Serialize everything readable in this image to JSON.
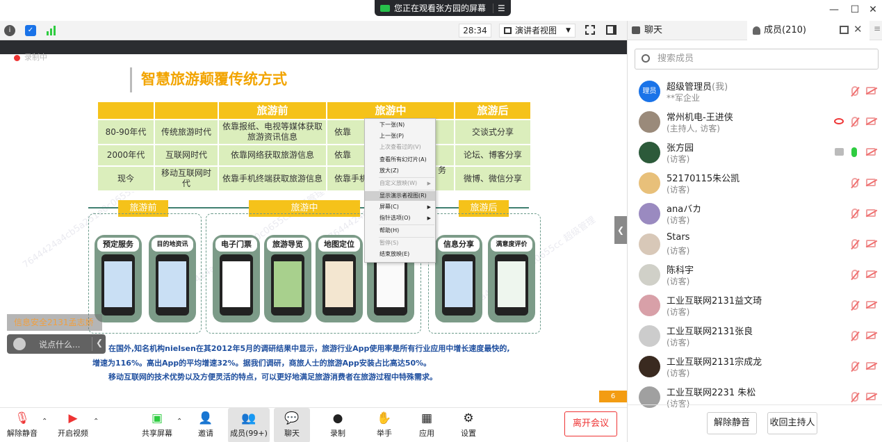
{
  "topbar": {
    "viewing_text": "您正在观看张方园的屏幕",
    "menu_icon": "menu-icon"
  },
  "toolbar": {
    "timer": "28:34",
    "view_mode": "演讲者视图"
  },
  "slide": {
    "recording_label": "录制中",
    "title": "智慧旅游颠覆传统方式",
    "table": {
      "headers": [
        "",
        "",
        "旅游前",
        "旅游中",
        "旅游后"
      ],
      "rows": [
        [
          "80-90年代",
          "传统旅游时代",
          "依靠报纸、电视等媒体获取旅游资讯信息",
          "依靠",
          "交谈式分享"
        ],
        [
          "2000年代",
          "互联网时代",
          "依靠网络获取旅游信息",
          "依靠",
          "论坛、博客分享"
        ],
        [
          "现今",
          "移动互联网时代",
          "依靠手机终端获取旅游信息",
          "依靠手机",
          "微博、微信分享"
        ]
      ]
    },
    "stages": [
      "旅游前",
      "旅游中",
      "旅游后"
    ],
    "phases": [
      "预定服务",
      "目的地资讯",
      "电子门票",
      "旅游导览",
      "地图定位",
      "信息分享",
      "满意度评价"
    ],
    "context_menu": [
      {
        "label": "下一张(N)",
        "disabled": false
      },
      {
        "label": "上一张(P)",
        "disabled": false
      },
      {
        "label": "上次查看过的(V)",
        "disabled": true
      },
      {
        "label": "查看所有幻灯片(A)",
        "disabled": false
      },
      {
        "label": "放大(Z)",
        "disabled": false
      },
      {
        "label": "自定义放映(W)",
        "disabled": true
      },
      {
        "label": "显示演示者视图(R)",
        "disabled": false
      },
      {
        "label": "屏幕(C)",
        "disabled": false
      },
      {
        "label": "指针选项(O)",
        "disabled": false
      },
      {
        "label": "帮助(H)",
        "disabled": false
      },
      {
        "label": "暂停(S)",
        "disabled": true
      },
      {
        "label": "结束放映(E)",
        "disabled": false
      }
    ],
    "context_partial": "务",
    "bottom_lines": [
      "在国外,知名机构nielsen在其2012年5月的调研结果中显示，旅游行业App使用率是所有行业应用中增长速度最快的,",
      "增速为116%。高出App的平均增速32%。据我们调研，商旅人士的旅游App安装占比高达50%。",
      "移动互联网的技术优势以及方便灵活的特点，可以更好地满足旅游消费者在旅游过程中特殊需求。"
    ],
    "page_number": "6",
    "watermark": "7644424a4cb5a251e0c0655cc 超级管理"
  },
  "overlay": {
    "speaker_label": "信息安全2131孟志娇",
    "chat_placeholder": "说点什么..."
  },
  "bottom_toolbar": {
    "unmute": "解除静音",
    "start_video": "开启视频",
    "share": "共享屏幕",
    "invite": "邀请",
    "members": "成员(99+)",
    "chat": "聊天",
    "record": "录制",
    "raise": "举手",
    "apps": "应用",
    "settings": "设置",
    "leave": "离开会议"
  },
  "panel": {
    "tab_chat": "聊天",
    "tab_members": "成员(210)",
    "search_placeholder": "搜索成员",
    "members": [
      {
        "avatar": "理员",
        "name": "超级管理员",
        "tag": "(我)",
        "sub": "**军企业",
        "color": "#1a73e8"
      },
      {
        "avatar": "",
        "name": "常州机电-王进侠",
        "tag": "",
        "sub": "(主持人, 访客)",
        "color": "#9a8a7a"
      },
      {
        "avatar": "",
        "name": "张方园",
        "tag": "",
        "sub": "(访客)",
        "color": "#2c5a3a"
      },
      {
        "avatar": "",
        "name": "52170115朱公凯",
        "tag": "",
        "sub": "(访客)",
        "color": "#e8c07a"
      },
      {
        "avatar": "",
        "name": "anaバカ",
        "tag": "",
        "sub": "(访客)",
        "color": "#9a8ac0"
      },
      {
        "avatar": "",
        "name": "Stars",
        "tag": "",
        "sub": "(访客)",
        "color": "#d8c8b8"
      },
      {
        "avatar": "",
        "name": "陈科宇",
        "tag": "",
        "sub": "(访客)",
        "color": "#d0d0c8"
      },
      {
        "avatar": "",
        "name": "工业互联网2131益文琦",
        "tag": "",
        "sub": "(访客)",
        "color": "#d8a0a8"
      },
      {
        "avatar": "",
        "name": "工业互联网2131张良",
        "tag": "",
        "sub": "(访客)",
        "color": "#cccccc"
      },
      {
        "avatar": "",
        "name": "工业互联网2131宗成龙",
        "tag": "",
        "sub": "(访客)",
        "color": "#3a2a20"
      },
      {
        "avatar": "",
        "name": "工业互联网2231  朱松",
        "tag": "",
        "sub": "(访客)",
        "color": "#a0a0a0"
      }
    ],
    "btn_unmute": "解除静音",
    "btn_reclaim_host": "收回主持人"
  }
}
